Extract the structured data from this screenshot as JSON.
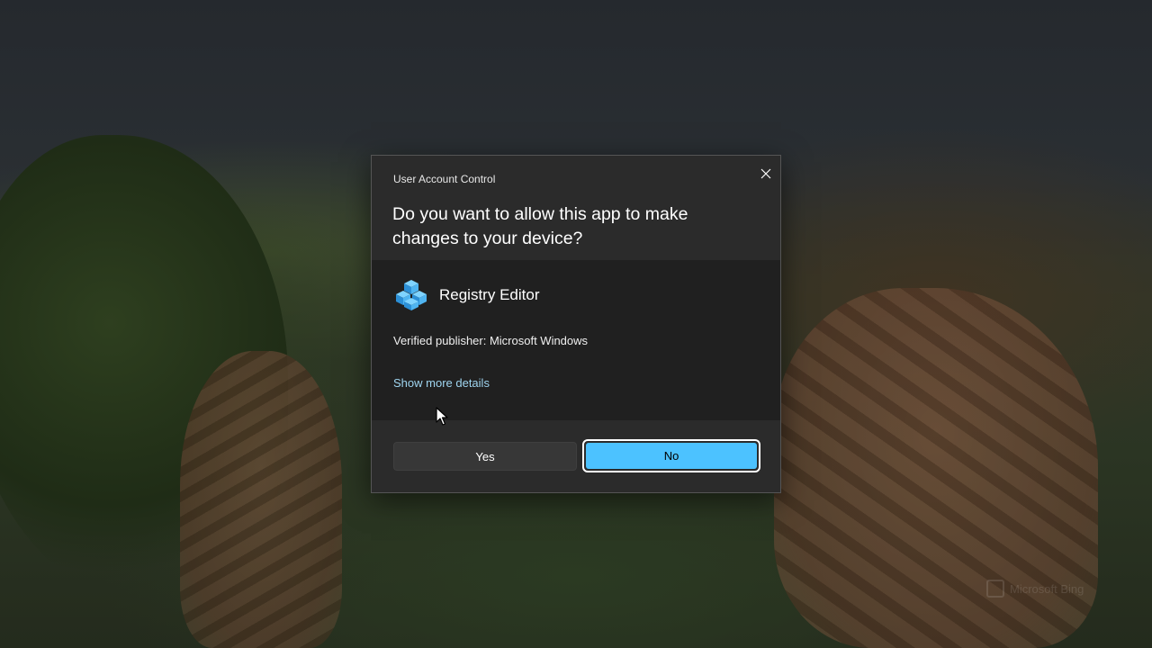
{
  "dialog": {
    "window_label": "User Account Control",
    "question": "Do you want to allow this app to make changes to your device?",
    "app_name": "Registry Editor",
    "publisher": "Verified publisher: Microsoft Windows",
    "details_link": "Show more details",
    "close_icon": "close-icon",
    "app_icon": "registry-editor-icon"
  },
  "buttons": {
    "yes": "Yes",
    "no": "No",
    "focused": "No"
  },
  "watermark": {
    "text": "Microsoft Bing"
  },
  "colors": {
    "accent": "#4cc2ff",
    "dialog_background": "#2b2b2b",
    "dialog_body": "#202020",
    "link": "#9fd5f0"
  }
}
